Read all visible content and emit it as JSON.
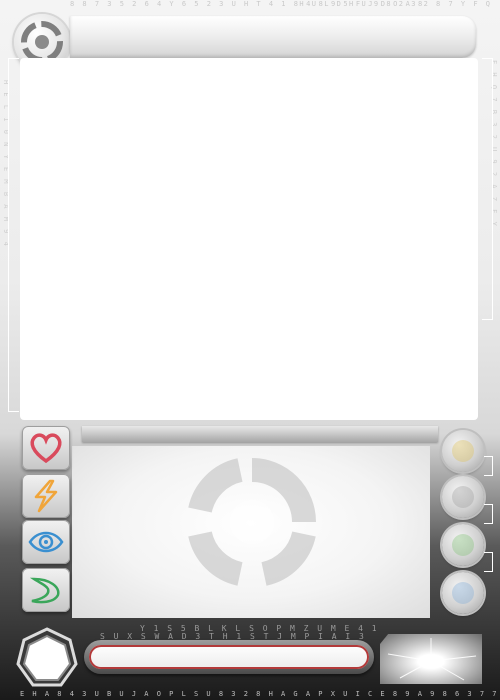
{
  "codes": {
    "top_left": "8 8 7 3 5 2 6 4 Y 6 5 2 3 U H T 4 1 8 4 8 9 5 F J D O A 8",
    "top_right": "H U L D H U 9 8 2 3 2 8 7 Y F Q",
    "mid_line_1": "Y 1 S 5 B L K L S O P M Z U M E 4 1",
    "mid_line_2": "S U X S W A D 3 T H 1 S T J M P I A I 3",
    "bottom": "E H A 8 4 3 U B U J A O P L S U 8 3 2 8 H A G A P X U I C E 8 9 A 9 8 6 3 7 7 A B 7 A 9",
    "left_vertical": "H E L 1 0 N Y E M B A M 9 4",
    "right_vertical": "F H Q 7 B 3 2 U 9 2 A Z F Y"
  },
  "icons": {
    "top_emblem": "target-emblem-icon",
    "stats": [
      "heart-icon",
      "lightning-bolt-icon",
      "eye-icon",
      "swoosh-icon"
    ],
    "orbs": [
      "orb-gem-icon",
      "orb-gem-icon",
      "orb-gem-icon",
      "orb-gem-icon"
    ],
    "level": "heptagon-level-icon",
    "watermark": "target-emblem-icon",
    "gem": "star-burst-gem-icon"
  },
  "colors": {
    "heart": "#d94a5c",
    "lightning": "#f0a53a",
    "eye": "#3a8fd0",
    "swoosh": "#3aa65a",
    "name_border": "#b33a3a",
    "orb_tints": [
      "#e0c050",
      "#9a9a9a",
      "#7ac070",
      "#7aa8d8"
    ]
  }
}
